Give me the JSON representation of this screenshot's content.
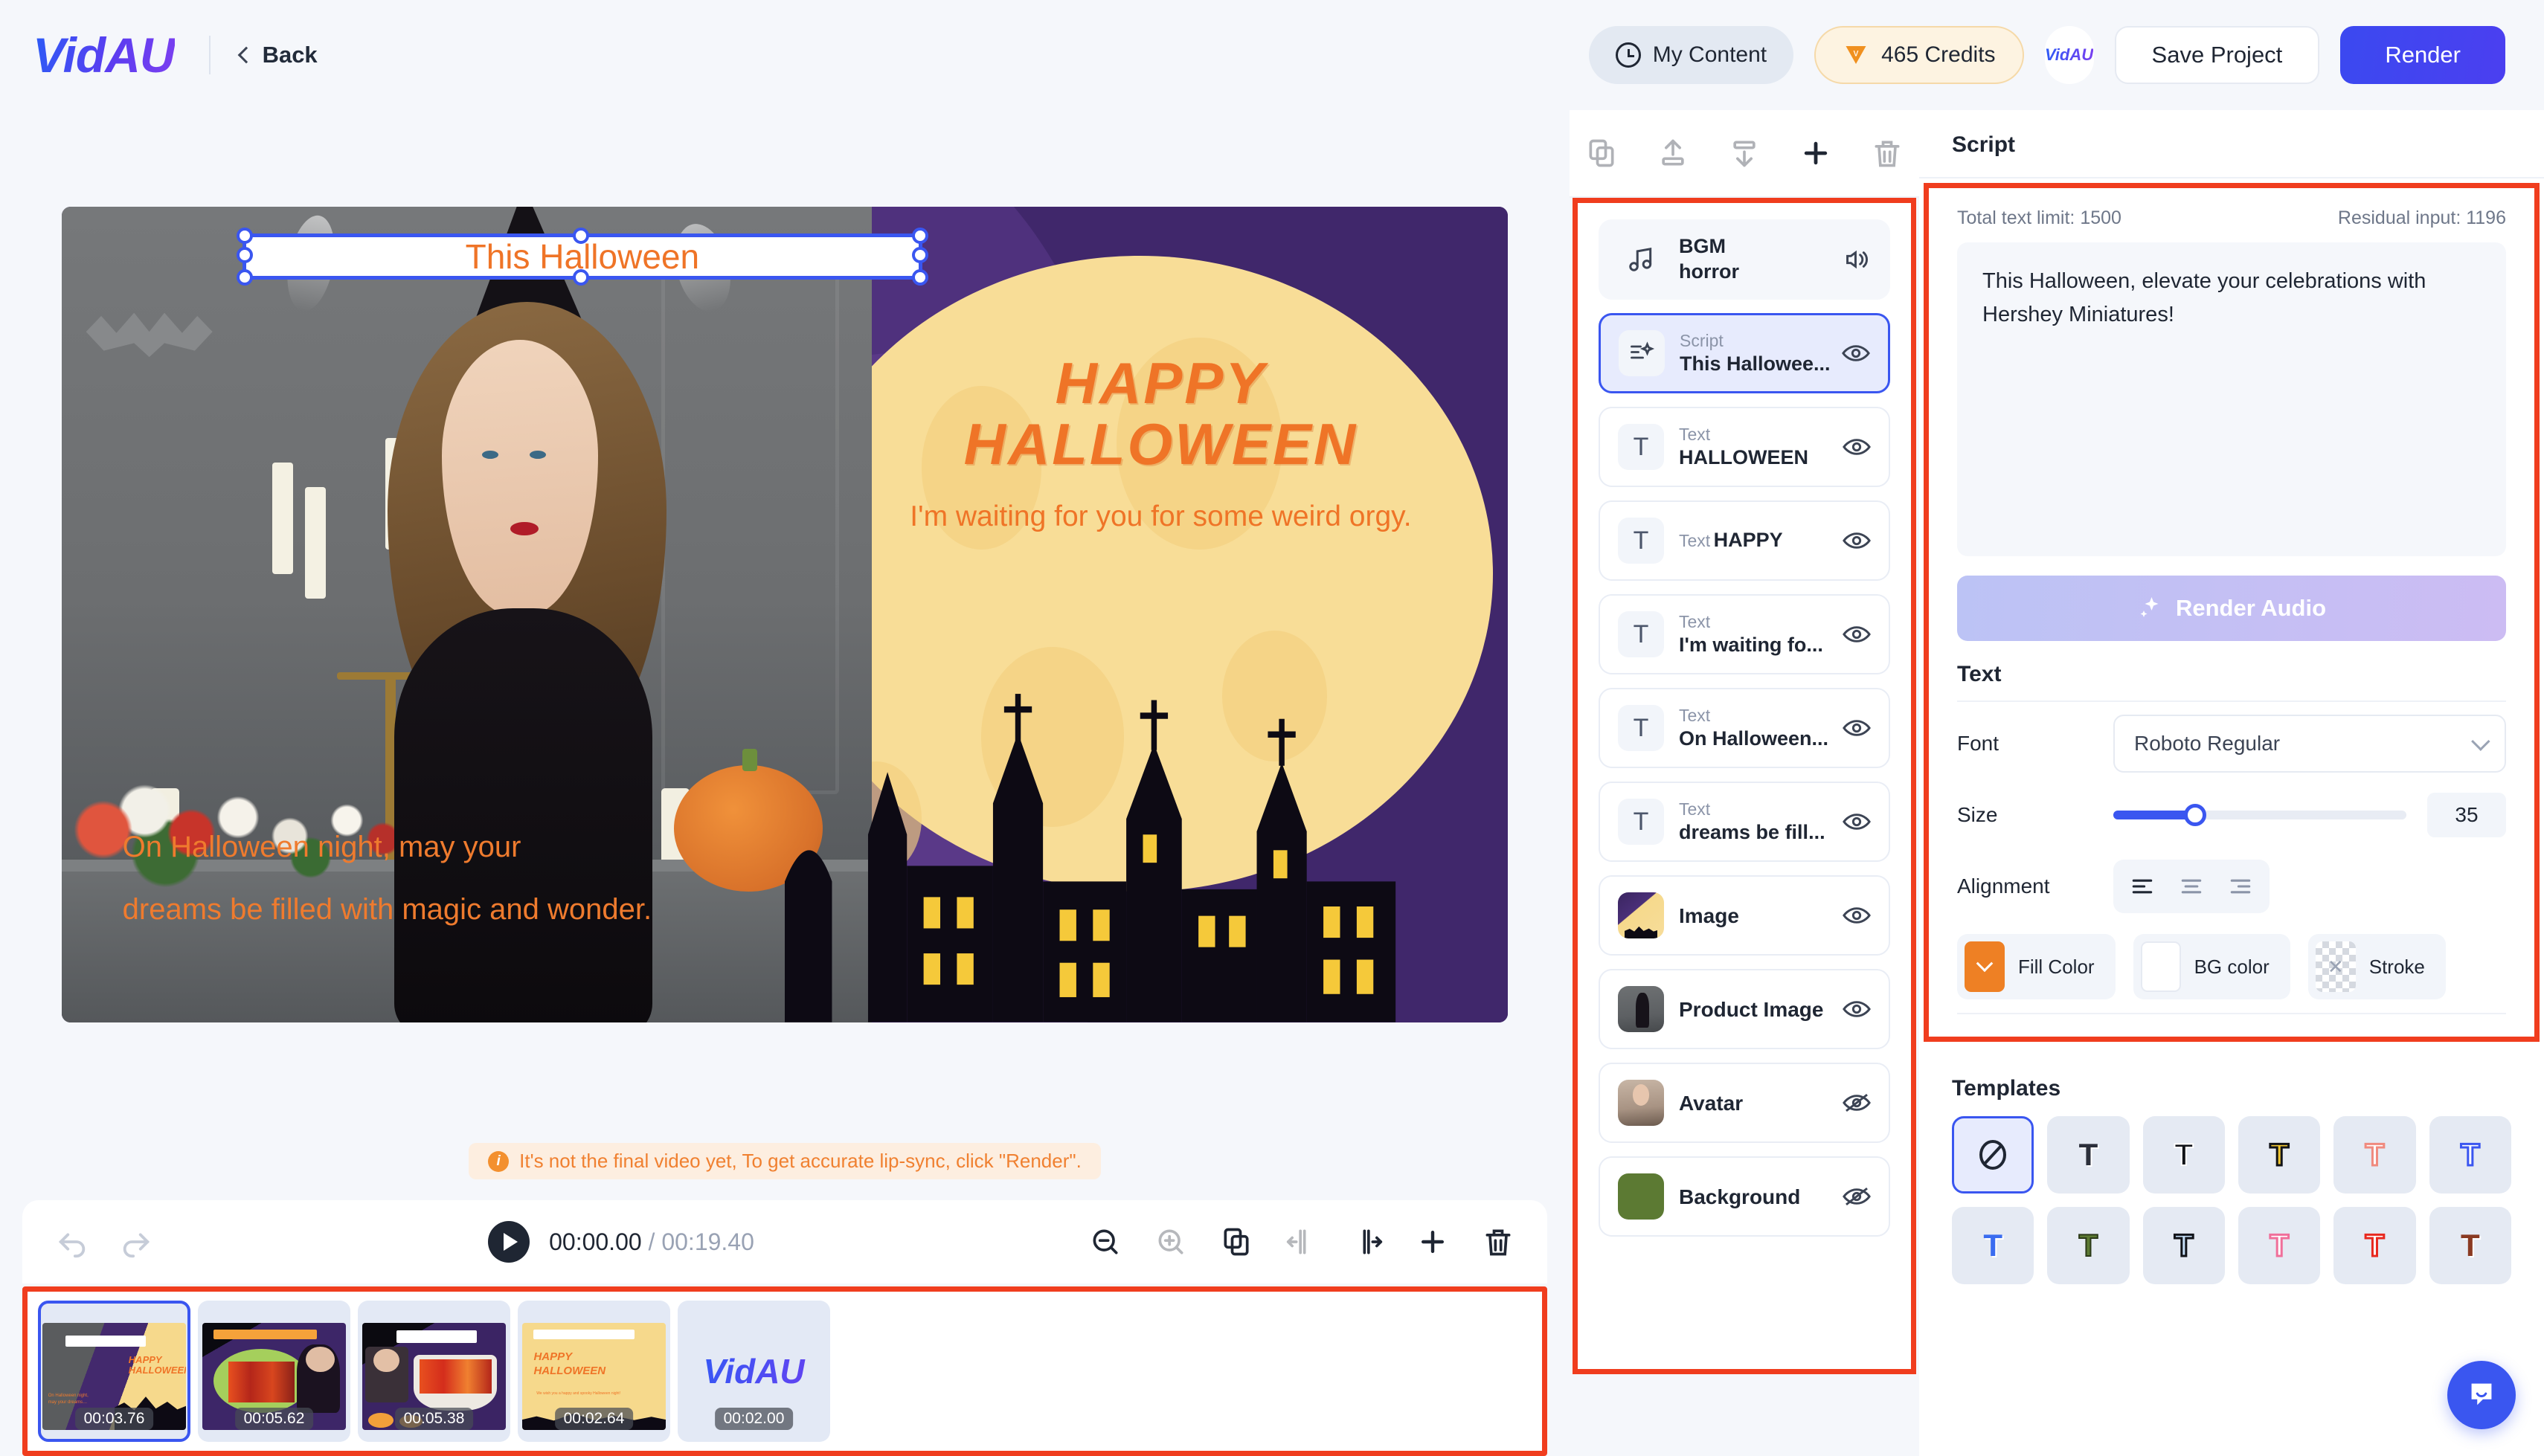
{
  "header": {
    "logo": "VidAU",
    "back_label": "Back",
    "my_content_label": "My Content",
    "credits_label": "465 Credits",
    "vidau_mini_label": "VidAU",
    "save_label": "Save Project",
    "render_label": "Render",
    "accent_color": "#3a49f0",
    "credits_color": "#f0901f"
  },
  "canvas": {
    "selected_text": "This Halloween",
    "headline_line1": "HAPPY",
    "headline_line2": "HALLOWEEN",
    "subhead": "I'm waiting for you for some weird orgy.",
    "bottom_line1": "On Halloween night, may your",
    "bottom_line2": "dreams be filled with magic and wonder.",
    "text_color": "#ef7427",
    "bg_purple": "#40276b",
    "moon_color": "#f7d98c"
  },
  "warning": {
    "text": "It's not the final video yet, To get accurate lip-sync, click \"Render\".",
    "icon": "info-icon",
    "color": "#f08030"
  },
  "timeline": {
    "undo_icon": "undo-icon",
    "redo_icon": "redo-icon",
    "play_icon": "play-icon",
    "current_time": "00:00.00",
    "separator": "/",
    "total_time": "00:19.40",
    "tools": [
      {
        "name": "zoom-out-icon",
        "enabled": true
      },
      {
        "name": "zoom-in-icon",
        "enabled": false
      },
      {
        "name": "duplicate-icon",
        "enabled": true
      },
      {
        "name": "split-left-icon",
        "enabled": false
      },
      {
        "name": "split-right-icon",
        "enabled": true
      },
      {
        "name": "add-icon",
        "enabled": true
      },
      {
        "name": "delete-icon",
        "enabled": true
      }
    ],
    "clips": [
      {
        "duration": "00:03.76",
        "selected": true,
        "kind": "scene"
      },
      {
        "duration": "00:05.62",
        "selected": false,
        "kind": "scene"
      },
      {
        "duration": "00:05.38",
        "selected": false,
        "kind": "scene"
      },
      {
        "duration": "00:02.64",
        "selected": false,
        "kind": "scene"
      },
      {
        "duration": "00:02.00",
        "selected": false,
        "kind": "logo",
        "label": "VidAU"
      }
    ]
  },
  "layers_panel": {
    "toolbar": [
      {
        "name": "copy-layer-icon",
        "enabled": false
      },
      {
        "name": "bring-to-front-icon",
        "enabled": false
      },
      {
        "name": "send-to-back-icon",
        "enabled": false
      },
      {
        "name": "add-layer-icon",
        "enabled": true
      },
      {
        "name": "delete-layer-icon",
        "enabled": false
      }
    ],
    "items": [
      {
        "kind": "BGM",
        "name": "horror",
        "icon": "music-note-icon",
        "vis": "audio",
        "active": false,
        "style": "bgm"
      },
      {
        "kind": "Script",
        "name": "This Hallowee...",
        "icon": "script-icon",
        "vis": "visible",
        "active": true
      },
      {
        "kind": "Text",
        "name": "HALLOWEEN",
        "icon": "text-icon",
        "vis": "visible",
        "active": false
      },
      {
        "kind": "Text",
        "name": "HAPPY",
        "icon": "text-icon",
        "vis": "visible",
        "active": false
      },
      {
        "kind": "Text",
        "name": "I'm waiting fo...",
        "icon": "text-icon",
        "vis": "visible",
        "active": false
      },
      {
        "kind": "Text",
        "name": "On Halloween...",
        "icon": "text-icon",
        "vis": "visible",
        "active": false
      },
      {
        "kind": "Text",
        "name": "dreams be fill...",
        "icon": "text-icon",
        "vis": "visible",
        "active": false
      },
      {
        "kind": "",
        "name": "Image",
        "icon": "image-thumb",
        "vis": "visible",
        "active": false
      },
      {
        "kind": "",
        "name": "Product Image",
        "icon": "product-thumb",
        "vis": "visible",
        "active": false
      },
      {
        "kind": "",
        "name": "Avatar",
        "icon": "avatar-thumb",
        "vis": "hidden",
        "active": false
      },
      {
        "kind": "",
        "name": "Background",
        "icon": "bg-thumb",
        "vis": "hidden",
        "active": false,
        "color": "#5c7a33"
      }
    ]
  },
  "props": {
    "title": "Script",
    "text_limit_label": "Total text limit: 1500",
    "residual_label": "Residual input: 1196",
    "script_value": "This Halloween, elevate your celebrations with Hershey Miniatures!",
    "render_audio_label": "Render Audio",
    "text_section_title": "Text",
    "font_label": "Font",
    "font_value": "Roboto Regular",
    "size_label": "Size",
    "size_value": "35",
    "size_percent": 28,
    "alignment_label": "Alignment",
    "alignment_options": [
      "align-left-icon",
      "align-center-icon",
      "align-right-icon"
    ],
    "alignment_selected": 0,
    "fill_color_label": "Fill Color",
    "fill_color_value": "#ee8024",
    "bg_color_label": "BG color",
    "bg_color_value": "#ffffff",
    "stroke_label": "Stroke",
    "stroke_value": "none",
    "templates_title": "Templates",
    "templates": [
      {
        "glyph": "none",
        "color": "#1f2633",
        "selected": true
      },
      {
        "glyph": "T",
        "color": "#2b2f3a",
        "selected": false
      },
      {
        "glyph": "T",
        "color": "#111318",
        "selected": false
      },
      {
        "glyph": "T",
        "color": "#f2c832",
        "selected": false
      },
      {
        "glyph": "T",
        "color": "#f08a7e",
        "selected": false
      },
      {
        "glyph": "T",
        "color": "#3a56f0",
        "selected": false
      },
      {
        "glyph": "T",
        "color": "#3a6cf0",
        "selected": false
      },
      {
        "glyph": "T",
        "color": "#5c7a33",
        "selected": false
      },
      {
        "glyph": "T",
        "color": "#c3dcf5",
        "selected": false
      },
      {
        "glyph": "T",
        "color": "#f06f9a",
        "selected": false
      },
      {
        "glyph": "T",
        "color": "#e8281e",
        "selected": false
      },
      {
        "glyph": "T",
        "color": "#8a3a22",
        "selected": false
      }
    ]
  },
  "chat": {
    "icon": "chat-bubble-icon"
  }
}
